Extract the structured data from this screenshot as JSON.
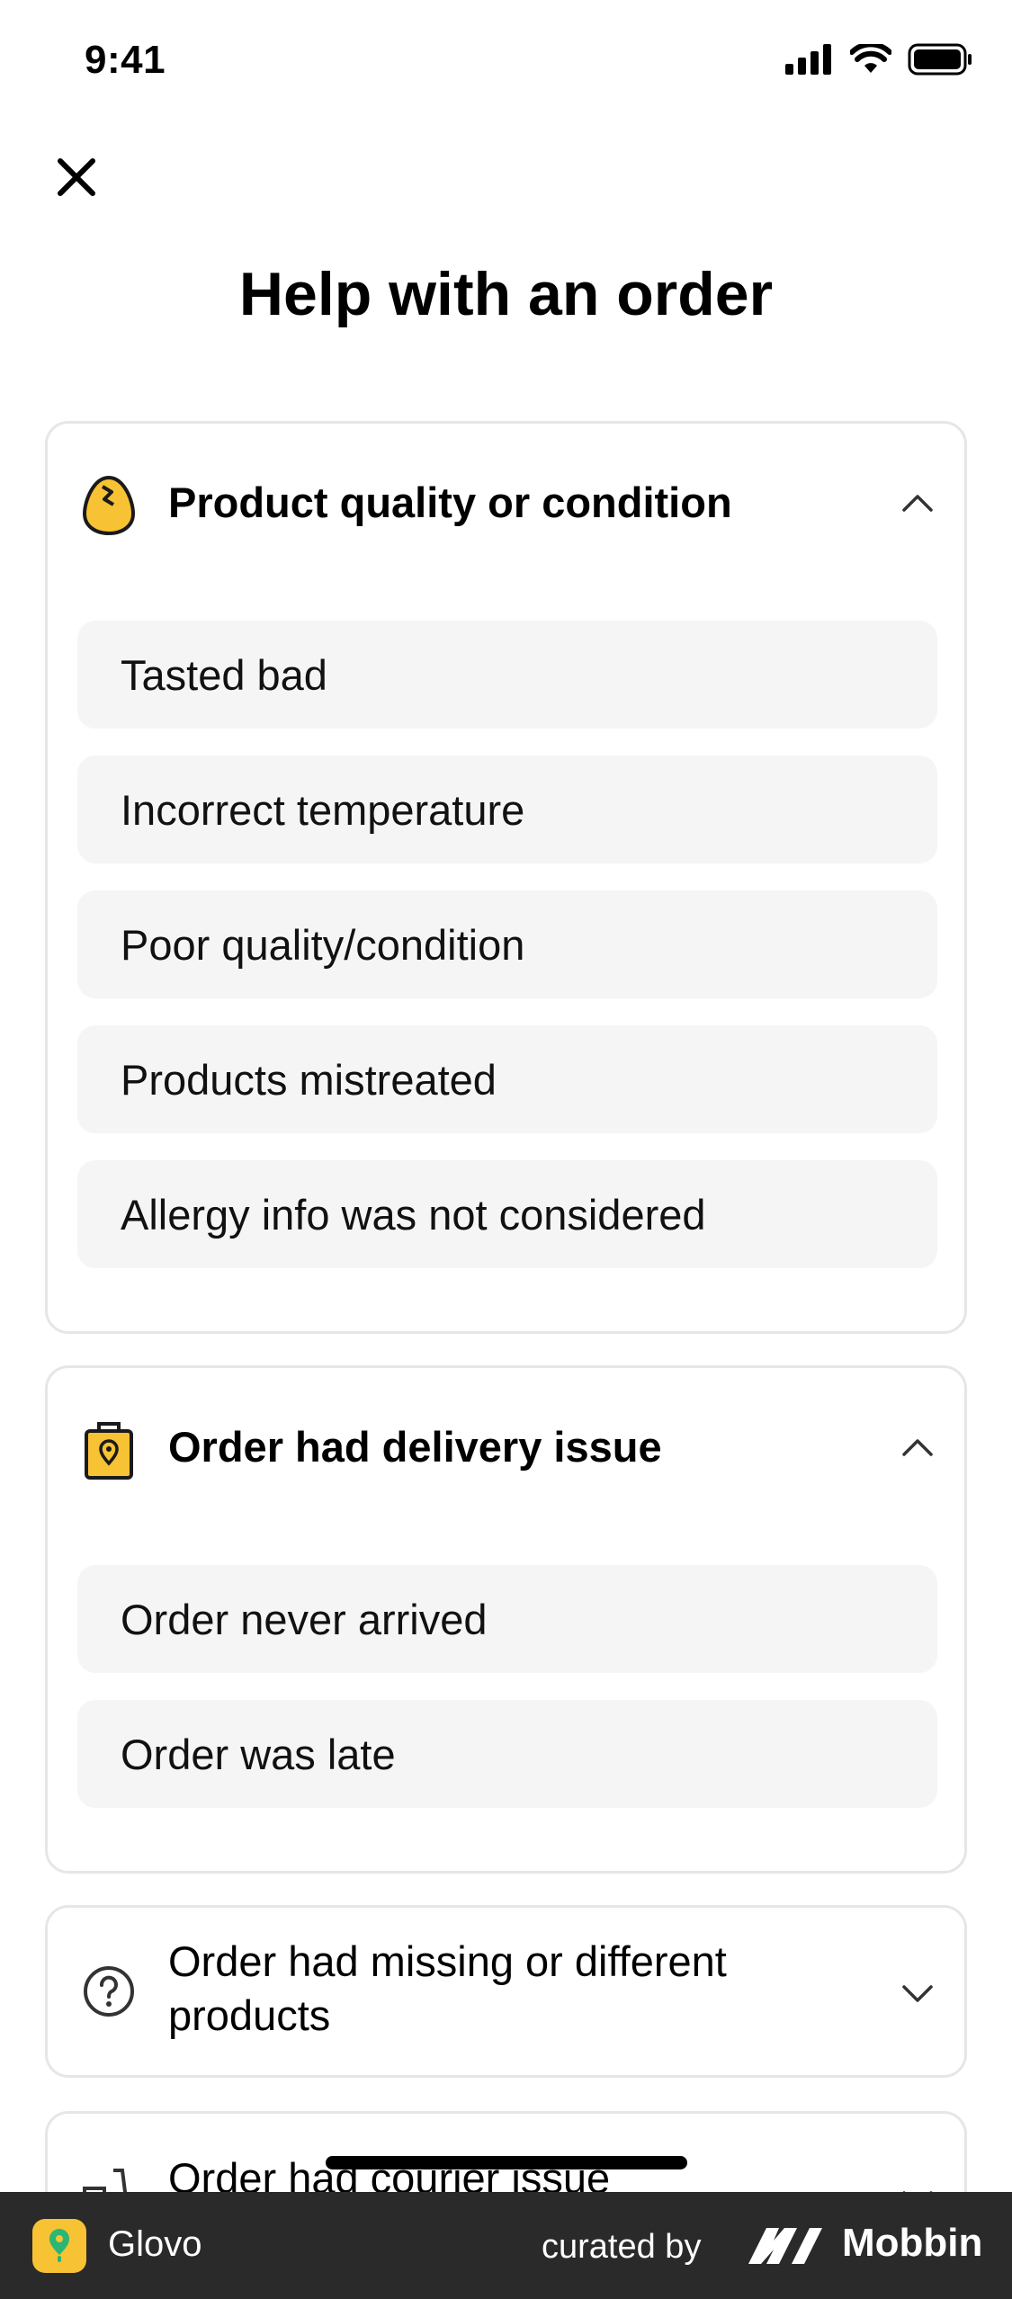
{
  "status_bar": {
    "time": "9:41"
  },
  "header": {
    "title": "Help with an order"
  },
  "sections": [
    {
      "title": "Product quality or condition",
      "icon": "cracked-egg-icon",
      "expanded": true,
      "options": [
        "Tasted bad",
        "Incorrect temperature",
        "Poor quality/condition",
        "Products mistreated",
        "Allergy info was not considered"
      ]
    },
    {
      "title": "Order had delivery issue",
      "icon": "location-bag-icon",
      "expanded": true,
      "options": [
        "Order never arrived",
        "Order was late"
      ]
    },
    {
      "title": "Order had missing or different products",
      "icon": "question-circle-icon",
      "expanded": false,
      "options": []
    },
    {
      "title": "Order had courier issue",
      "icon": "scooter-icon",
      "expanded": false,
      "options": []
    }
  ],
  "footer": {
    "app_name": "Glovo",
    "curated_label": "curated by",
    "brand": "Mobbin"
  },
  "colors": {
    "accent_yellow": "#f7c234",
    "option_bg": "#f5f5f5",
    "card_border": "#e6e6e6",
    "footer_bg": "#2a2a2a"
  }
}
